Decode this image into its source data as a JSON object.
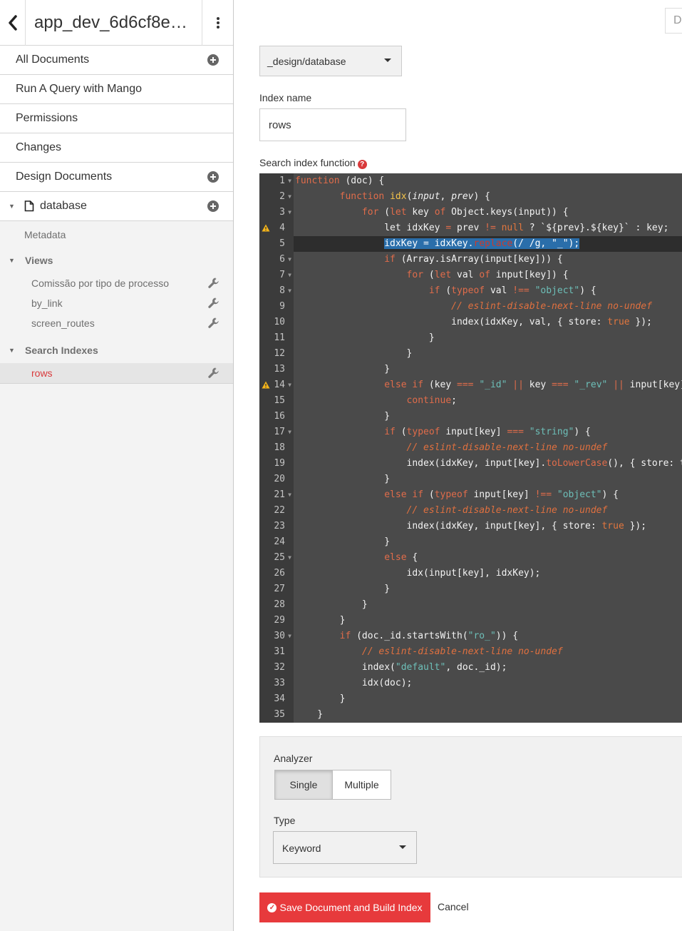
{
  "header": {
    "db_title": "app_dev_6d6cf8e…"
  },
  "sidebar": {
    "nav": [
      {
        "label": "All Documents",
        "has_add": true
      },
      {
        "label": "Run A Query with Mango",
        "has_add": false
      },
      {
        "label": "Permissions",
        "has_add": false
      },
      {
        "label": "Changes",
        "has_add": false
      },
      {
        "label": "Design Documents",
        "has_add": true
      }
    ],
    "ddoc_name": "database",
    "metadata_label": "Metadata",
    "views_label": "Views",
    "views": [
      "Comissão por tipo de processo",
      "by_link",
      "screen_routes"
    ],
    "search_indexes_label": "Search Indexes",
    "search_indexes": [
      "rows"
    ]
  },
  "main": {
    "search_partial": "De",
    "design_doc_value": "_design/database",
    "index_name_label": "Index name",
    "index_name_value": "rows",
    "search_fn_label": "Search index function",
    "analyzer_label": "Analyzer",
    "analyzer_options": [
      "Single",
      "Multiple"
    ],
    "type_label": "Type",
    "type_value": "Keyword",
    "save_label": "Save Document and Build Index",
    "cancel_label": "Cancel"
  },
  "editor": {
    "warning_lines": [
      4,
      14
    ],
    "active_line": 5,
    "code_lines": [
      "function (doc) {",
      "        function idx(input, prev) {",
      "            for (let key of Object.keys(input)) {",
      "                let idxKey = prev != null ? `${prev}.${key}` : key;",
      "                idxKey = idxKey.replace(/ /g, \"_\");",
      "                if (Array.isArray(input[key])) {",
      "                    for (let val of input[key]) {",
      "                        if (typeof val !== \"object\") {",
      "                            // eslint-disable-next-line no-undef",
      "                            index(idxKey, val, { store: true });",
      "                        }",
      "                    }",
      "                }",
      "                else if (key === \"_id\" || key === \"_rev\" || input[key]",
      "                    continue;",
      "                }",
      "                if (typeof input[key] === \"string\") {",
      "                    // eslint-disable-next-line no-undef",
      "                    index(idxKey, input[key].toLowerCase(), { store: t",
      "                }",
      "                else if (typeof input[key] !== \"object\") {",
      "                    // eslint-disable-next-line no-undef",
      "                    index(idxKey, input[key], { store: true });",
      "                }",
      "                else {",
      "                    idx(input[key], idxKey);",
      "                }",
      "            }",
      "        }",
      "        if (doc._id.startsWith(\"ro_\")) {",
      "            // eslint-disable-next-line no-undef",
      "            index(\"default\", doc._id);",
      "            idx(doc);",
      "        }",
      "    }"
    ]
  },
  "colors": {
    "accent_red": "#e73a3c",
    "editor_bg": "#4a4a4a",
    "gutter_bg": "#3b3b3b",
    "keyword": "#e06c4a",
    "string": "#6dbfb8",
    "selection": "#2a6eaa"
  }
}
